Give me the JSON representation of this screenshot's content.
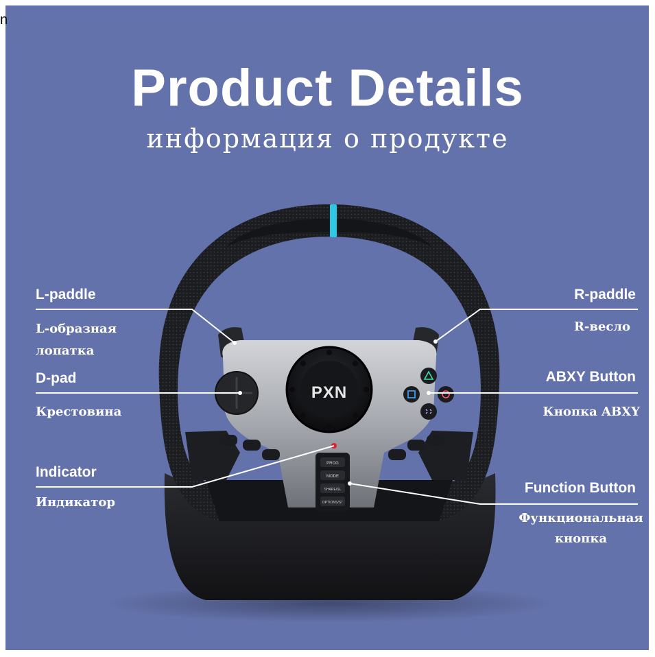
{
  "header": {
    "edge_text": "n",
    "title": "Product Details",
    "subtitle": "информация о продукте"
  },
  "brand": {
    "logo_text": "PXN"
  },
  "panel_buttons": {
    "prog": "PROG",
    "mode": "MODE",
    "share": "SHARE/SL",
    "options": "OPTIONS/ST"
  },
  "labels": {
    "l_paddle": {
      "en": "L-paddle",
      "ru_line1": "L-образная",
      "ru_line2": "лопатка"
    },
    "r_paddle": {
      "en": "R-paddle",
      "ru": "R-весло"
    },
    "dpad": {
      "en": "D-pad",
      "ru": "Крестовина"
    },
    "abxy": {
      "en": "ABXY Button",
      "ru": "Кнопка ABXY"
    },
    "indicator": {
      "en": "Indicator",
      "ru": "Индикатор"
    },
    "function": {
      "en": "Function Button",
      "ru_line1": "Функциональная",
      "ru_line2": "кнопка"
    }
  },
  "colors": {
    "background": "#6472ab",
    "accent_stripe": "#2ec8e6",
    "indicator_led": "#e0202a"
  }
}
